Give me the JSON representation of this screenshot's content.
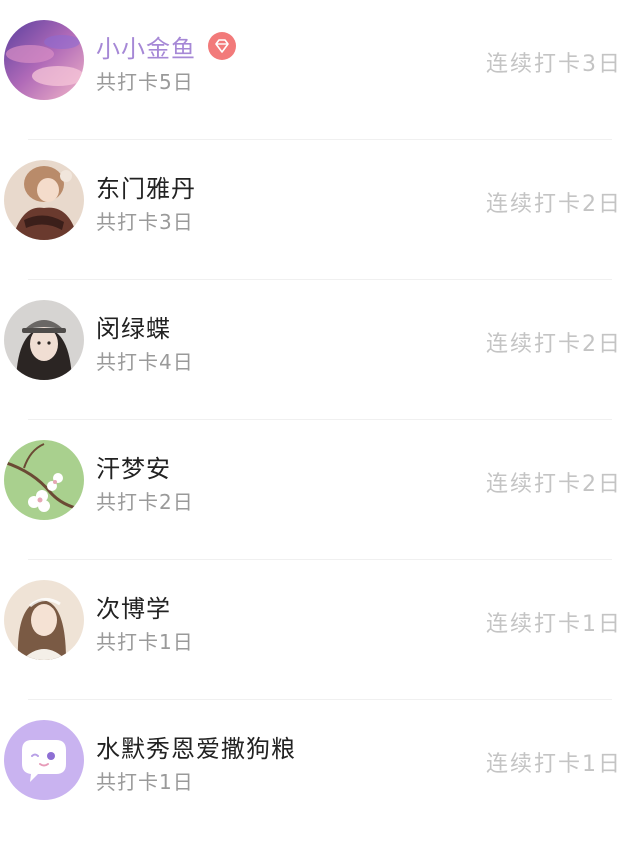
{
  "members": [
    {
      "name": "小小金鱼",
      "vip": true,
      "total": "共打卡5日",
      "streak": "连续打卡3日",
      "avatar_icon": "purple-sky-avatar"
    },
    {
      "name": "东门雅丹",
      "vip": false,
      "total": "共打卡3日",
      "streak": "连续打卡2日",
      "avatar_icon": "anime-girl-avatar"
    },
    {
      "name": "闵绿蝶",
      "vip": false,
      "total": "共打卡4日",
      "streak": "连续打卡2日",
      "avatar_icon": "girl-hat-avatar"
    },
    {
      "name": "汗梦安",
      "vip": false,
      "total": "共打卡2日",
      "streak": "连续打卡2日",
      "avatar_icon": "blossom-branch-avatar"
    },
    {
      "name": "次博学",
      "vip": false,
      "total": "共打卡1日",
      "streak": "连续打卡1日",
      "avatar_icon": "girl-portrait-avatar"
    },
    {
      "name": "水默秀恩爱撒狗粮",
      "vip": false,
      "total": "共打卡1日",
      "streak": "连续打卡1日",
      "avatar_icon": "default-chat-avatar"
    }
  ],
  "colors": {
    "vip_name": "#a688d6",
    "vip_badge": "#f27a7a",
    "name": "#222222",
    "secondary": "#9a9a9a",
    "streak": "#c4c4c4",
    "default_avatar_bg": "#c9b3f0"
  }
}
